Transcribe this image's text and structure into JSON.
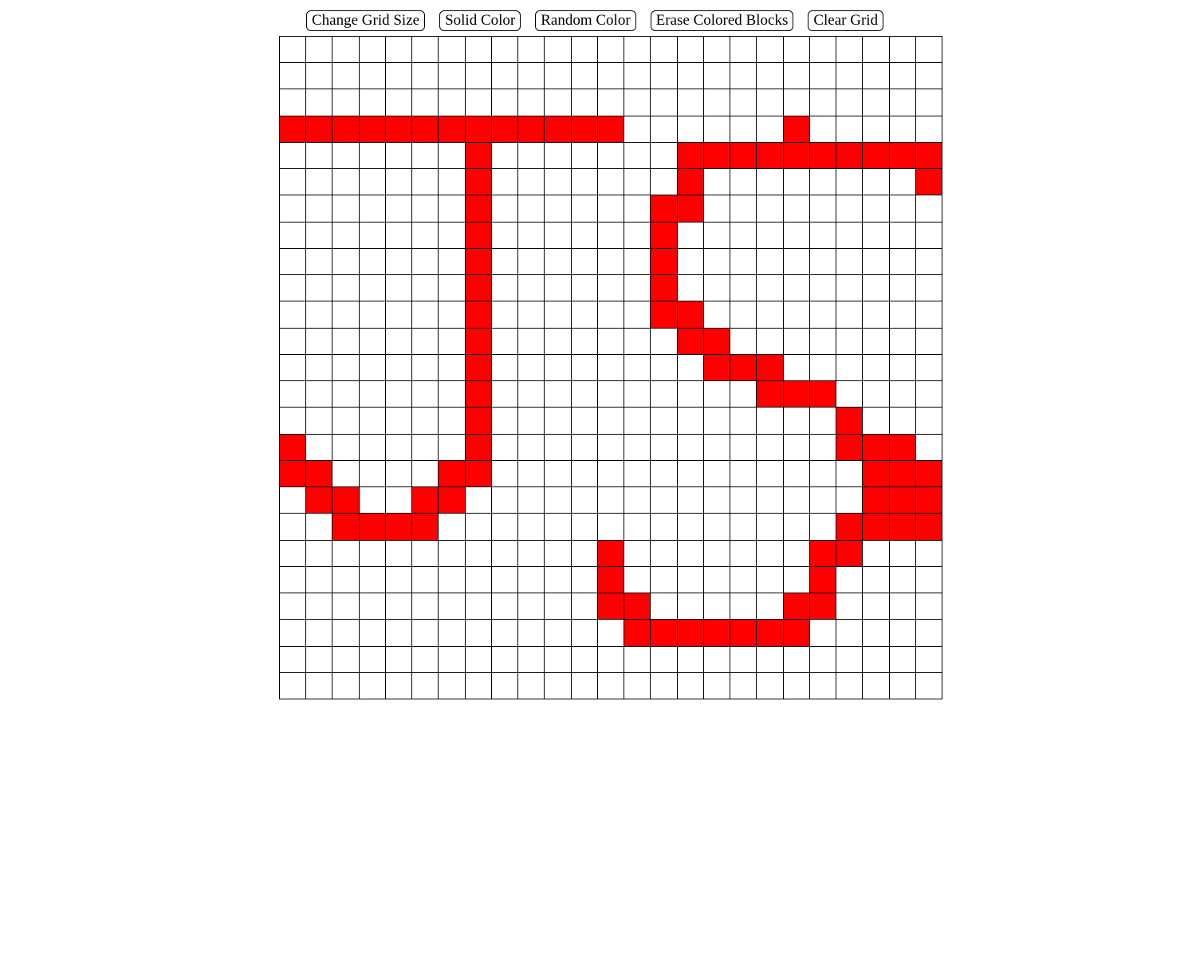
{
  "toolbar": {
    "change_grid_size_label": "Change Grid Size",
    "solid_color_label": "Solid Color",
    "random_color_label": "Random Color",
    "erase_colored_blocks_label": "Erase Colored Blocks",
    "clear_grid_label": "Clear Grid"
  },
  "grid": {
    "size": 25,
    "fill_color": "#ff0000",
    "empty_color": "#ffffff",
    "filled_cells": [
      [
        3,
        0
      ],
      [
        3,
        1
      ],
      [
        3,
        2
      ],
      [
        3,
        3
      ],
      [
        3,
        4
      ],
      [
        3,
        5
      ],
      [
        3,
        6
      ],
      [
        3,
        7
      ],
      [
        3,
        8
      ],
      [
        3,
        9
      ],
      [
        3,
        10
      ],
      [
        3,
        11
      ],
      [
        3,
        12
      ],
      [
        3,
        19
      ],
      [
        4,
        7
      ],
      [
        4,
        15
      ],
      [
        4,
        16
      ],
      [
        4,
        17
      ],
      [
        4,
        18
      ],
      [
        4,
        19
      ],
      [
        4,
        20
      ],
      [
        4,
        21
      ],
      [
        4,
        22
      ],
      [
        4,
        23
      ],
      [
        4,
        24
      ],
      [
        5,
        7
      ],
      [
        5,
        15
      ],
      [
        5,
        24
      ],
      [
        6,
        7
      ],
      [
        6,
        14
      ],
      [
        6,
        15
      ],
      [
        7,
        7
      ],
      [
        7,
        14
      ],
      [
        8,
        7
      ],
      [
        8,
        14
      ],
      [
        9,
        7
      ],
      [
        9,
        14
      ],
      [
        10,
        7
      ],
      [
        10,
        14
      ],
      [
        10,
        15
      ],
      [
        11,
        7
      ],
      [
        11,
        15
      ],
      [
        11,
        16
      ],
      [
        12,
        7
      ],
      [
        12,
        16
      ],
      [
        12,
        17
      ],
      [
        12,
        18
      ],
      [
        13,
        7
      ],
      [
        13,
        18
      ],
      [
        13,
        19
      ],
      [
        13,
        20
      ],
      [
        14,
        7
      ],
      [
        14,
        21
      ],
      [
        15,
        0
      ],
      [
        15,
        7
      ],
      [
        15,
        21
      ],
      [
        15,
        22
      ],
      [
        15,
        23
      ],
      [
        16,
        0
      ],
      [
        16,
        1
      ],
      [
        16,
        6
      ],
      [
        16,
        7
      ],
      [
        16,
        22
      ],
      [
        16,
        23
      ],
      [
        16,
        24
      ],
      [
        17,
        1
      ],
      [
        17,
        2
      ],
      [
        17,
        5
      ],
      [
        17,
        6
      ],
      [
        17,
        22
      ],
      [
        17,
        23
      ],
      [
        17,
        24
      ],
      [
        18,
        2
      ],
      [
        18,
        3
      ],
      [
        18,
        4
      ],
      [
        18,
        5
      ],
      [
        18,
        21
      ],
      [
        18,
        22
      ],
      [
        18,
        23
      ],
      [
        18,
        24
      ],
      [
        19,
        12
      ],
      [
        19,
        20
      ],
      [
        19,
        21
      ],
      [
        20,
        12
      ],
      [
        20,
        20
      ],
      [
        21,
        12
      ],
      [
        21,
        13
      ],
      [
        21,
        19
      ],
      [
        21,
        20
      ],
      [
        22,
        13
      ],
      [
        22,
        14
      ],
      [
        22,
        15
      ],
      [
        22,
        16
      ],
      [
        22,
        17
      ],
      [
        22,
        18
      ],
      [
        22,
        19
      ]
    ]
  }
}
